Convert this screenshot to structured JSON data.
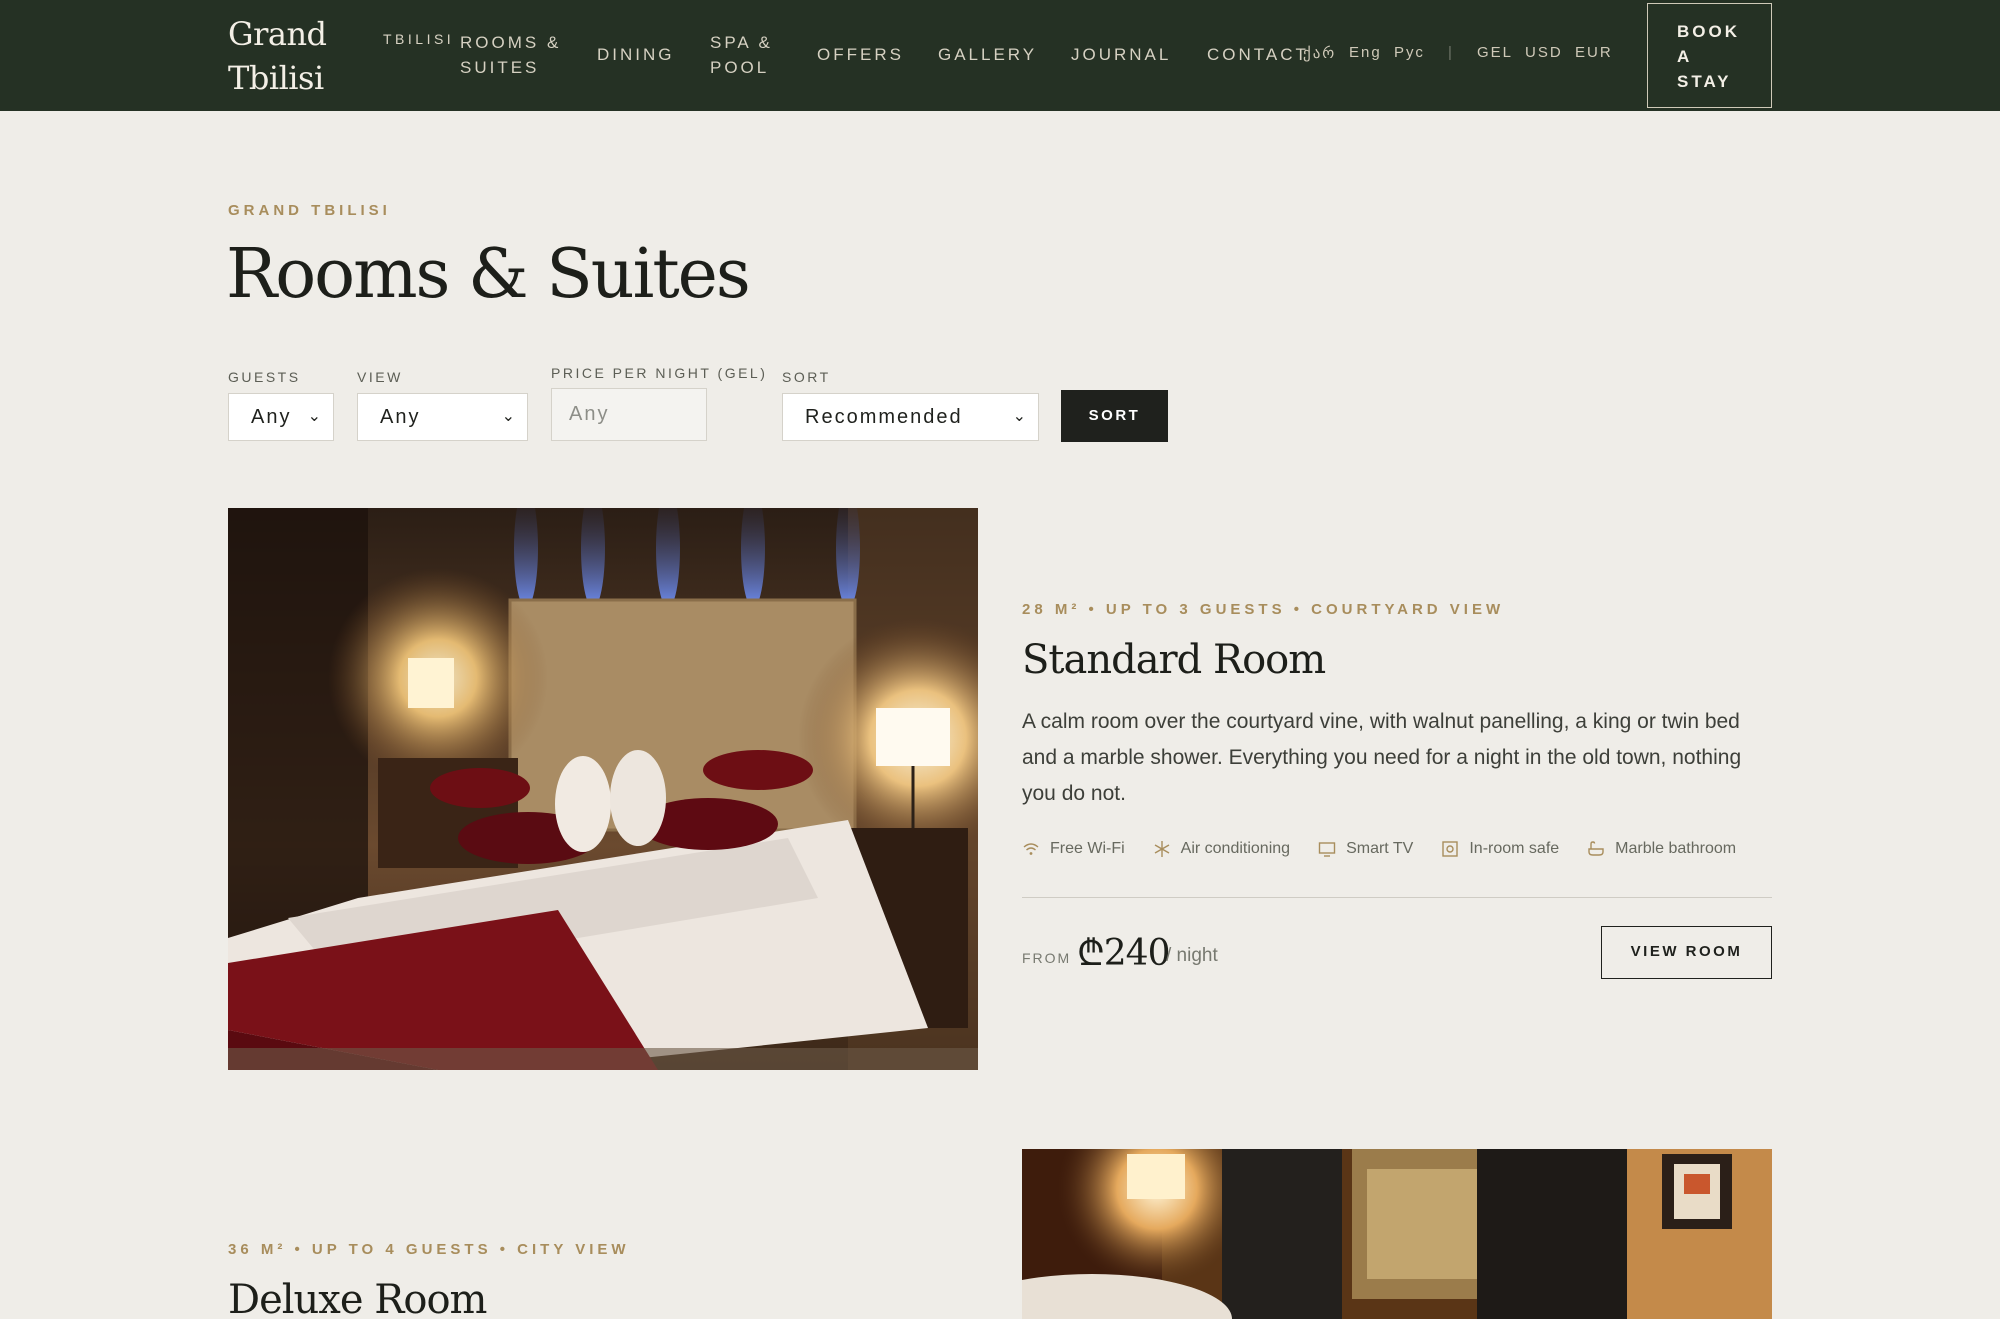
{
  "header": {
    "logo_line1": "Grand",
    "logo_line2": "Tbilisi",
    "logo_sub": "TBILISI",
    "nav": [
      "ROOMS &",
      "SUITES",
      "DINING",
      "SPA &",
      "POOL",
      "OFFERS",
      "GALLERY",
      "JOURNAL",
      "CONTACT"
    ],
    "languages": [
      "ქარ",
      "Eng",
      "Рус"
    ],
    "divider": "|",
    "currencies": [
      "GEL",
      "USD",
      "EUR"
    ],
    "book_cta": [
      "BOOK",
      "A",
      "STAY"
    ]
  },
  "page": {
    "eyebrow": "GRAND TBILISI",
    "title": "Rooms & Suites"
  },
  "filters": {
    "guests": {
      "label": "GUESTS",
      "value": "Any"
    },
    "view": {
      "label": "VIEW",
      "value": "Any"
    },
    "price": {
      "label": "PRICE PER NIGHT (GEL)",
      "placeholder": "Any"
    },
    "sort": {
      "label": "SORT",
      "value": "Recommended"
    },
    "submit": "SORT"
  },
  "rooms": [
    {
      "meta": "28 M² • UP TO 3 GUESTS • COURTYARD VIEW",
      "title": "Standard Room",
      "description": "A calm room over the courtyard vine, with walnut panelling, a king or twin bed and a marble shower. Everything you need for a night in the old town, nothing you do not.",
      "amenities": [
        {
          "icon": "wifi-icon",
          "label": "Free Wi-Fi"
        },
        {
          "icon": "snowflake-icon",
          "label": "Air conditioning"
        },
        {
          "icon": "tv-icon",
          "label": "Smart TV"
        },
        {
          "icon": "safe-icon",
          "label": "In-room safe"
        },
        {
          "icon": "bath-icon",
          "label": "Marble bathroom"
        }
      ],
      "price_prefix": "FROM",
      "price": "₾240",
      "price_suffix": "/ night",
      "cta": "VIEW ROOM"
    },
    {
      "meta": "36 M² • UP TO 4 GUESTS • CITY VIEW",
      "title": "Deluxe Room"
    }
  ],
  "colors": {
    "header_bg": "#253124",
    "page_bg": "#efede8",
    "accent_gold": "#a88d5c",
    "button_dark": "#1f211d"
  }
}
